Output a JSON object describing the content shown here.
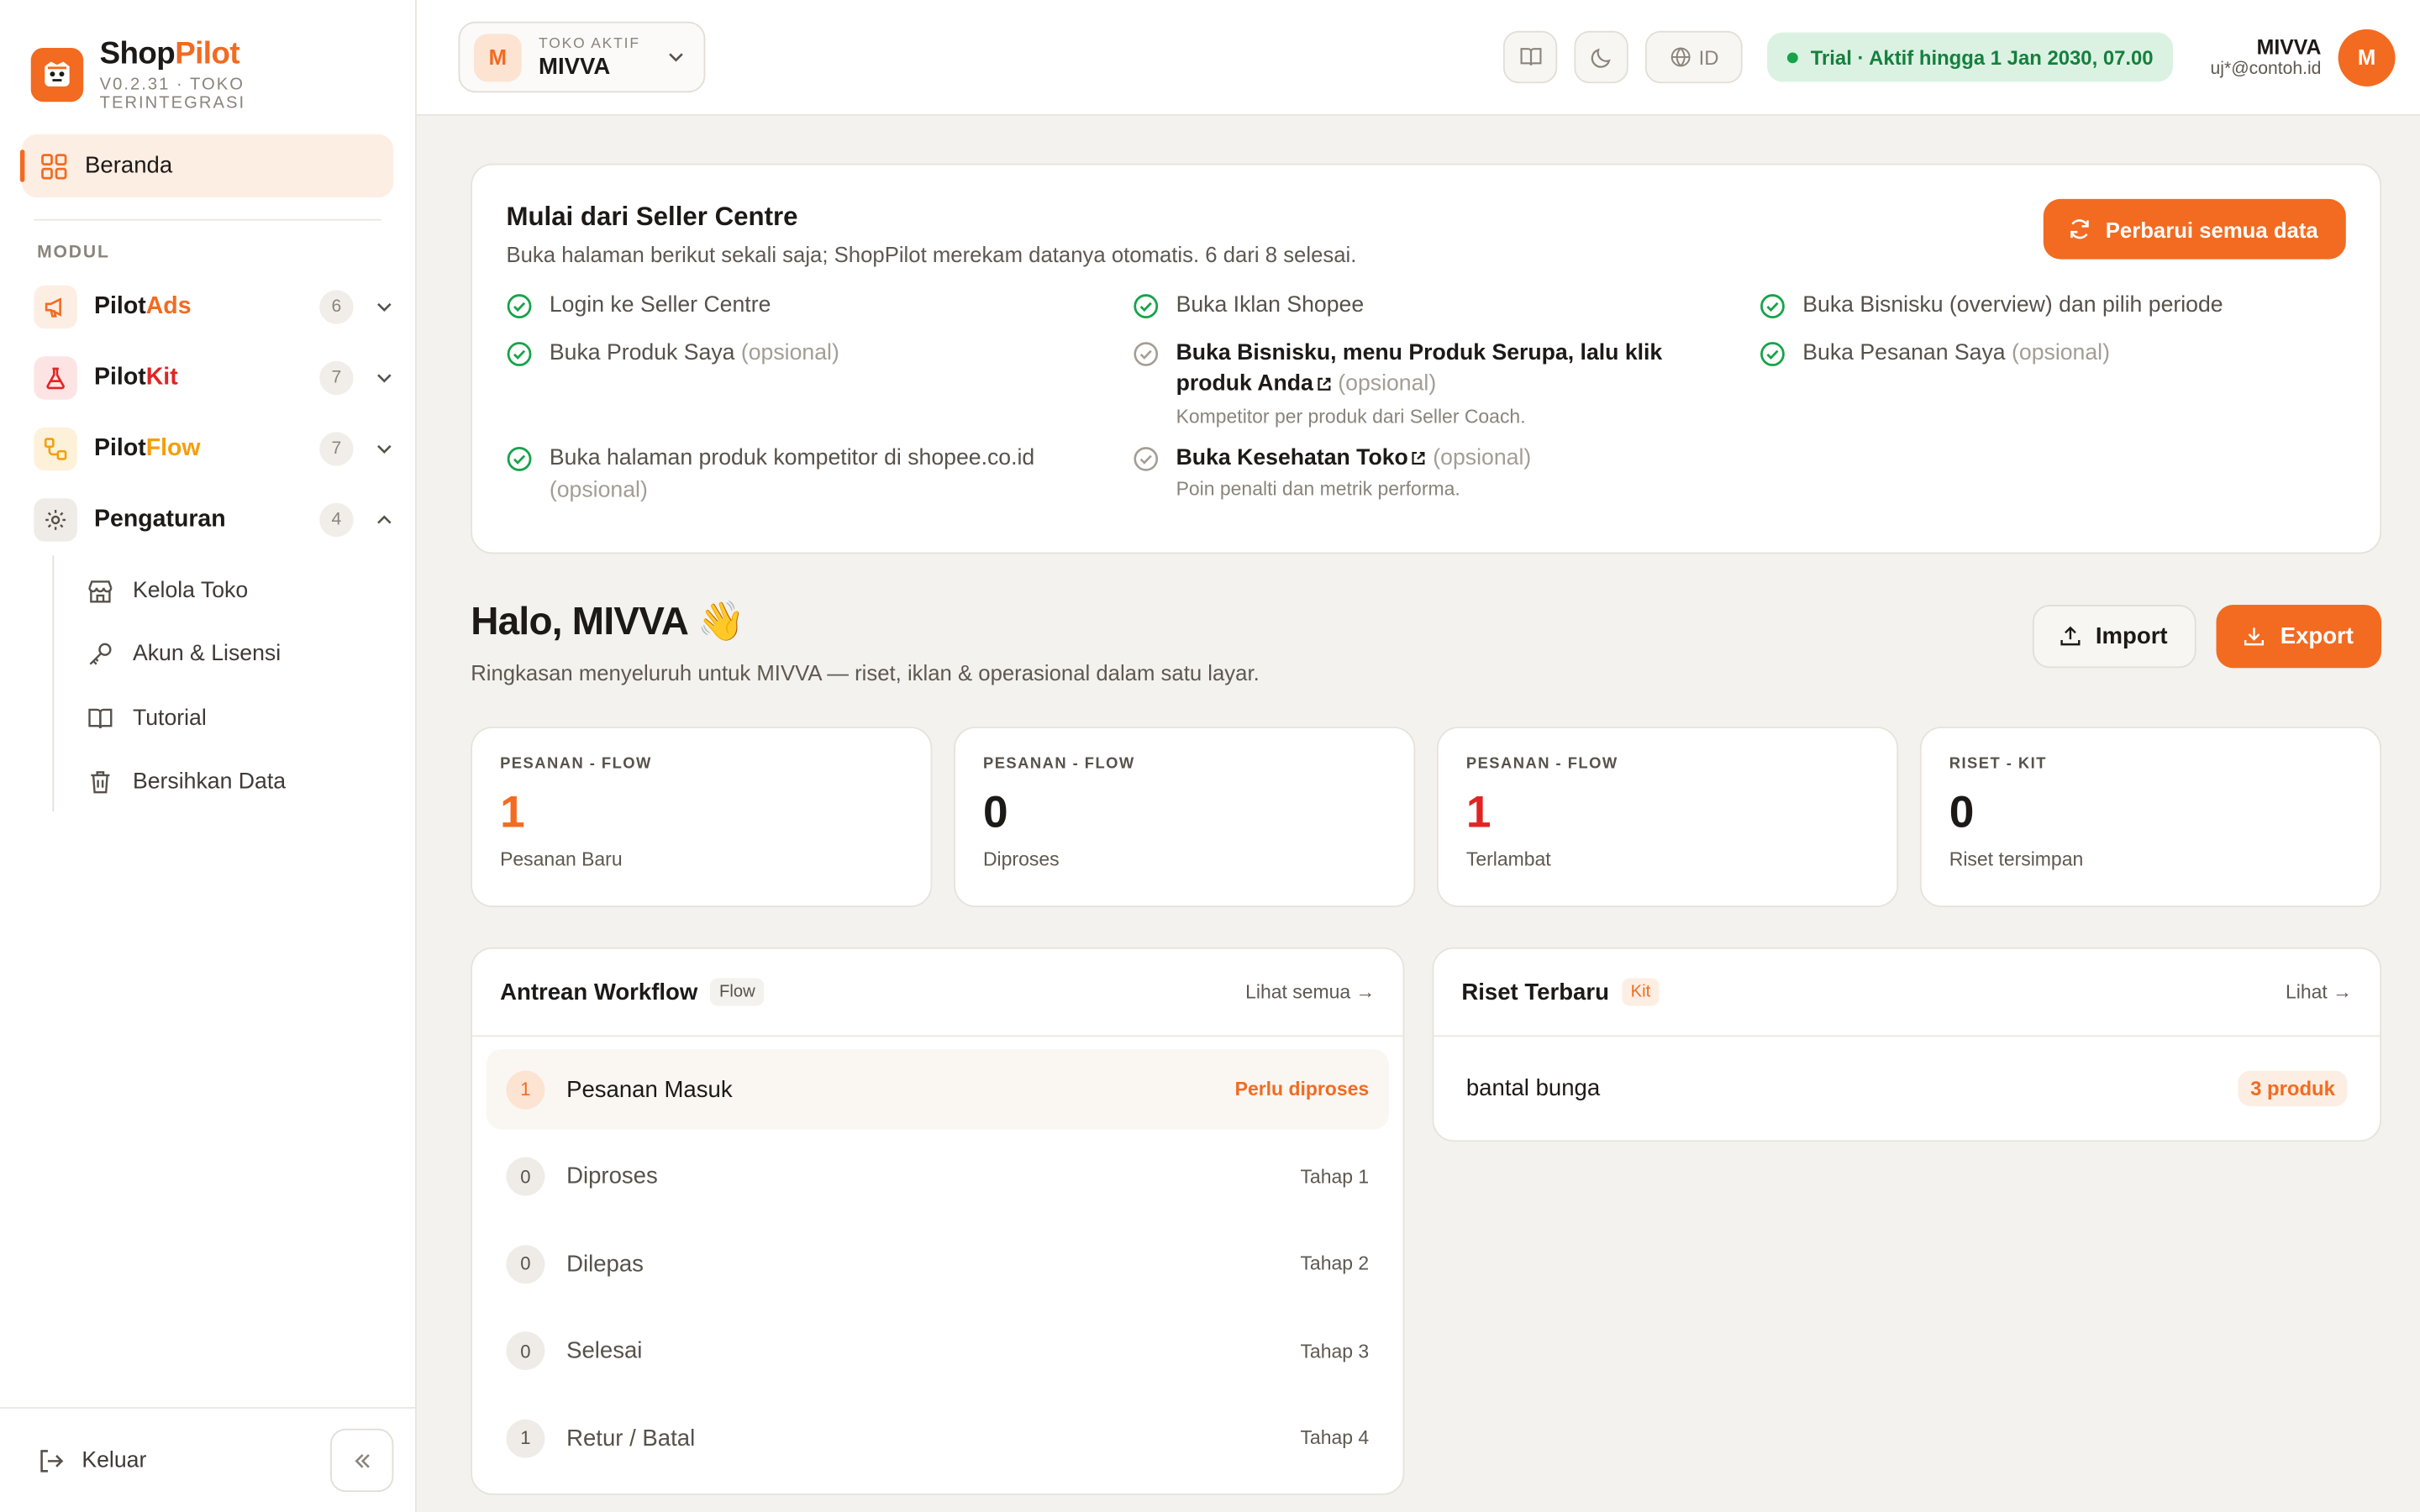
{
  "brand": {
    "name_a": "Shop",
    "name_b": "Pilot",
    "subtitle": "V0.2.31 · TOKO TERINTEGRASI"
  },
  "colors": {
    "accent": "#f26b21",
    "success": "#16a34a",
    "kit": "#e02424",
    "flow": "#f59e0b"
  },
  "sidebar": {
    "home_label": "Beranda",
    "section_label": "MODUL",
    "modules": [
      {
        "a": "Pilot",
        "b": "Ads",
        "count": "6",
        "icon": "megaphone-icon"
      },
      {
        "a": "Pilot",
        "b": "Kit",
        "count": "7",
        "icon": "flask-icon"
      },
      {
        "a": "Pilot",
        "b": "Flow",
        "count": "7",
        "icon": "flow-icon"
      },
      {
        "a": "Pengaturan",
        "b": "",
        "count": "4",
        "icon": "gear-icon"
      }
    ],
    "settings_items": [
      "Kelola Toko",
      "Akun & Lisensi",
      "Tutorial",
      "Bersihkan Data"
    ],
    "logout_label": "Keluar"
  },
  "topbar": {
    "store_key": "TOKO AKTIF",
    "store_name": "MIVVA",
    "store_initial": "M",
    "lang": "ID",
    "trial": "Trial · Aktif hingga 1 Jan 2030, 07.00",
    "user_name": "MIVVA",
    "user_email": "uj*@contoh.id",
    "user_initial": "M"
  },
  "onboarding": {
    "title": "Mulai dari Seller Centre",
    "subtitle": "Buka halaman berikut sekali saja; ShopPilot merekam datanya otomatis. 6 dari 8 selesai.",
    "refresh_label": "Perbarui semua data",
    "tasks": {
      "t1": "Login ke Seller Centre",
      "t2": "Buka Iklan Shopee",
      "t3": "Buka Bisnisku (overview) dan pilih periode",
      "t4": "Buka Produk Saya",
      "t4_opt": "(opsional)",
      "t5": "Buka Bisnisku, menu Produk Serupa, lalu klik produk Anda",
      "t5_opt": "(opsional)",
      "t5_hint": "Kompetitor per produk dari Seller Coach.",
      "t6": "Buka Pesanan Saya",
      "t6_opt": "(opsional)",
      "t7": "Buka halaman produk kompetitor di shopee.co.id",
      "t7_opt": "(opsional)",
      "t8": "Buka Kesehatan Toko",
      "t8_opt": "(opsional)",
      "t8_hint": "Poin penalti dan metrik performa."
    }
  },
  "greeting": {
    "title": "Halo, MIVVA 👋",
    "subtitle": "Ringkasan menyeluruh untuk MIVVA — riset, iklan & operasional dalam satu layar.",
    "import_label": "Import",
    "export_label": "Export"
  },
  "stats": [
    {
      "key": "PESANAN - FLOW",
      "value": "1",
      "label": "Pesanan Baru",
      "color": "#f26b21"
    },
    {
      "key": "PESANAN - FLOW",
      "value": "0",
      "label": "Diproses",
      "color": "#1c1917"
    },
    {
      "key": "PESANAN - FLOW",
      "value": "1",
      "label": "Terlambat",
      "color": "#e02424"
    },
    {
      "key": "RISET - KIT",
      "value": "0",
      "label": "Riset tersimpan",
      "color": "#1c1917"
    }
  ],
  "workflow": {
    "title": "Antrean Workflow",
    "tag": "Flow",
    "more": "Lihat semua →",
    "rows": [
      {
        "n": "1",
        "name": "Pesanan Masuk",
        "right": "Perlu diproses"
      },
      {
        "n": "0",
        "name": "Diproses",
        "right": "Tahap 1"
      },
      {
        "n": "0",
        "name": "Dilepas",
        "right": "Tahap 2"
      },
      {
        "n": "0",
        "name": "Selesai",
        "right": "Tahap 3"
      },
      {
        "n": "1",
        "name": "Retur / Batal",
        "right": "Tahap 4"
      }
    ]
  },
  "riset": {
    "title": "Riset Terbaru",
    "tag": "Kit",
    "more": "Lihat →",
    "item_name": "bantal bunga",
    "item_badge": "3 produk"
  }
}
